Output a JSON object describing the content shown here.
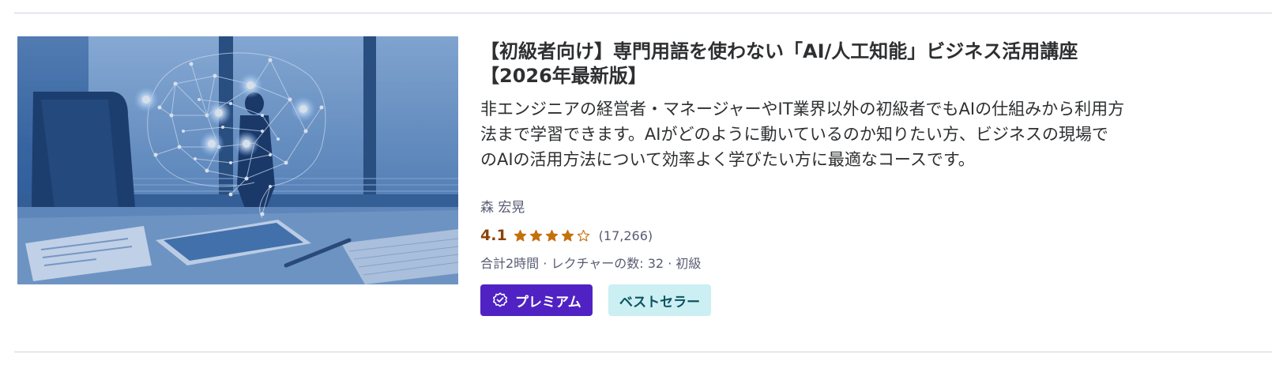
{
  "course": {
    "title_line1": "【初級者向け】専門用語を使わない「AI/人工知能」ビジネス活用講座",
    "title_line2": "【2026年最新版】",
    "description_line1": "非エンジニアの経営者・マネージャーやIT業界以外の初級者でもAIの仕組みから利用方",
    "description_line2": "法まで学習できます。AIがどのように動いているのか知りたい方、ビジネスの現場で",
    "description_line3": "のAIの活用方法について効率よく学びたい方に最適なコースです。",
    "instructor": "森 宏晃",
    "rating": "4.1",
    "rating_stars": 4.1,
    "rating_count": "(17,266)",
    "meta": "合計2時間 · レクチャーの数: 32 · 初級",
    "badge_premium": "プレミアム",
    "badge_bestseller": "ベストセラー"
  },
  "colors": {
    "rating": "#8b4309",
    "star": "#c4710d",
    "premium_bg": "#5022c3",
    "bestseller_bg": "#cbeff2",
    "bestseller_text": "#0d5261"
  },
  "icons": {
    "star": "star-icon",
    "premium": "premium-verified-icon"
  }
}
